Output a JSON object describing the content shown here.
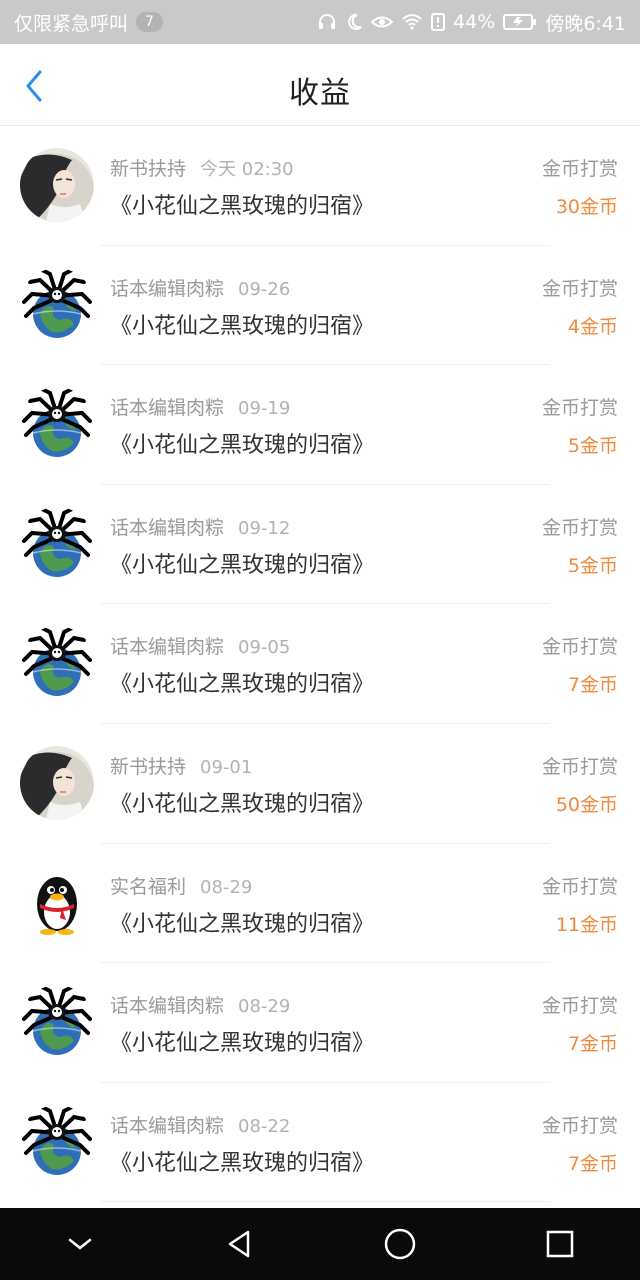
{
  "status_bar": {
    "carrier": "仅限紧急呼叫",
    "notification_count": "7",
    "battery": "44%",
    "time": "傍晚6:41"
  },
  "header": {
    "title": "收益"
  },
  "colors": {
    "accent": "#2a8ef0",
    "amount": "#f08a3c"
  },
  "items": [
    {
      "source": "新书扶持",
      "time": "今天 02:30",
      "book": "《小花仙之黑玫瑰的归宿》",
      "type": "金币打赏",
      "amount": "30金币",
      "avatar": "illustrated-character-avatar"
    },
    {
      "source": "话本编辑肉粽",
      "time": "09-26",
      "book": "《小花仙之黑玫瑰的归宿》",
      "type": "金币打赏",
      "amount": "4金币",
      "avatar": "globe-spider-avatar"
    },
    {
      "source": "话本编辑肉粽",
      "time": "09-19",
      "book": "《小花仙之黑玫瑰的归宿》",
      "type": "金币打赏",
      "amount": "5金币",
      "avatar": "globe-spider-avatar"
    },
    {
      "source": "话本编辑肉粽",
      "time": "09-12",
      "book": "《小花仙之黑玫瑰的归宿》",
      "type": "金币打赏",
      "amount": "5金币",
      "avatar": "globe-spider-avatar"
    },
    {
      "source": "话本编辑肉粽",
      "time": "09-05",
      "book": "《小花仙之黑玫瑰的归宿》",
      "type": "金币打赏",
      "amount": "7金币",
      "avatar": "globe-spider-avatar"
    },
    {
      "source": "新书扶持",
      "time": "09-01",
      "book": "《小花仙之黑玫瑰的归宿》",
      "type": "金币打赏",
      "amount": "50金币",
      "avatar": "illustrated-character-avatar"
    },
    {
      "source": "实名福利",
      "time": "08-29",
      "book": "《小花仙之黑玫瑰的归宿》",
      "type": "金币打赏",
      "amount": "11金币",
      "avatar": "penguin-avatar"
    },
    {
      "source": "话本编辑肉粽",
      "time": "08-29",
      "book": "《小花仙之黑玫瑰的归宿》",
      "type": "金币打赏",
      "amount": "7金币",
      "avatar": "globe-spider-avatar"
    },
    {
      "source": "话本编辑肉粽",
      "time": "08-22",
      "book": "《小花仙之黑玫瑰的归宿》",
      "type": "金币打赏",
      "amount": "7金币",
      "avatar": "globe-spider-avatar"
    }
  ],
  "nav": {
    "buttons": [
      "collapse-icon",
      "back-triangle-icon",
      "home-circle-icon",
      "recents-square-icon"
    ]
  }
}
